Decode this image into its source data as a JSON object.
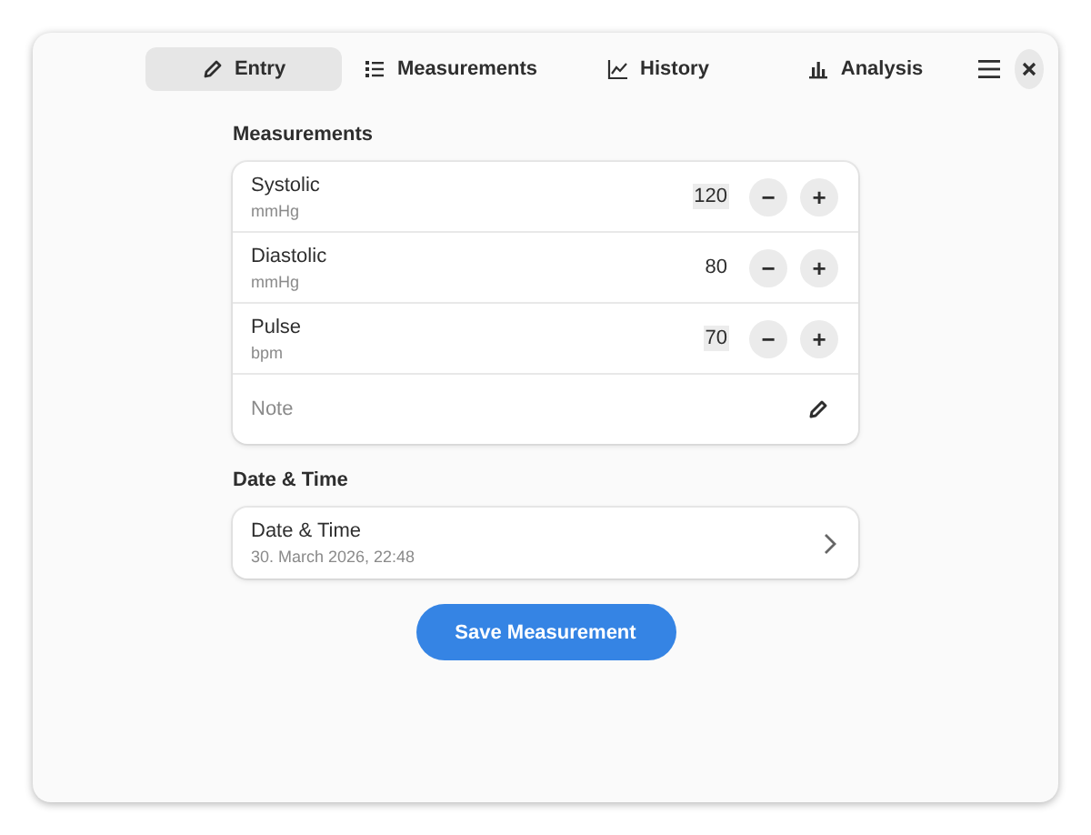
{
  "tabs": [
    {
      "label": "Entry",
      "kind": "pencil",
      "selected": true
    },
    {
      "label": "Measurements",
      "kind": "list",
      "selected": false
    },
    {
      "label": "History",
      "kind": "line",
      "selected": false
    },
    {
      "label": "Analysis",
      "kind": "bars",
      "selected": false
    }
  ],
  "measurements": {
    "heading": "Measurements",
    "rows": [
      {
        "label": "Systolic",
        "unit": "mmHg",
        "value": "120",
        "highlighted": true,
        "minus": "−",
        "plus": "+"
      },
      {
        "label": "Diastolic",
        "unit": "mmHg",
        "value": "80",
        "highlighted": false,
        "minus": "−",
        "plus": "+"
      },
      {
        "label": "Pulse",
        "unit": "bpm",
        "value": "70",
        "highlighted": true,
        "minus": "−",
        "plus": "+"
      }
    ],
    "note": {
      "placeholder": "Note"
    }
  },
  "date_time": {
    "heading": "Date & Time",
    "label": "Date & Time",
    "value": "30. March 2026, 22:48"
  },
  "save_button": "Save Measurement"
}
